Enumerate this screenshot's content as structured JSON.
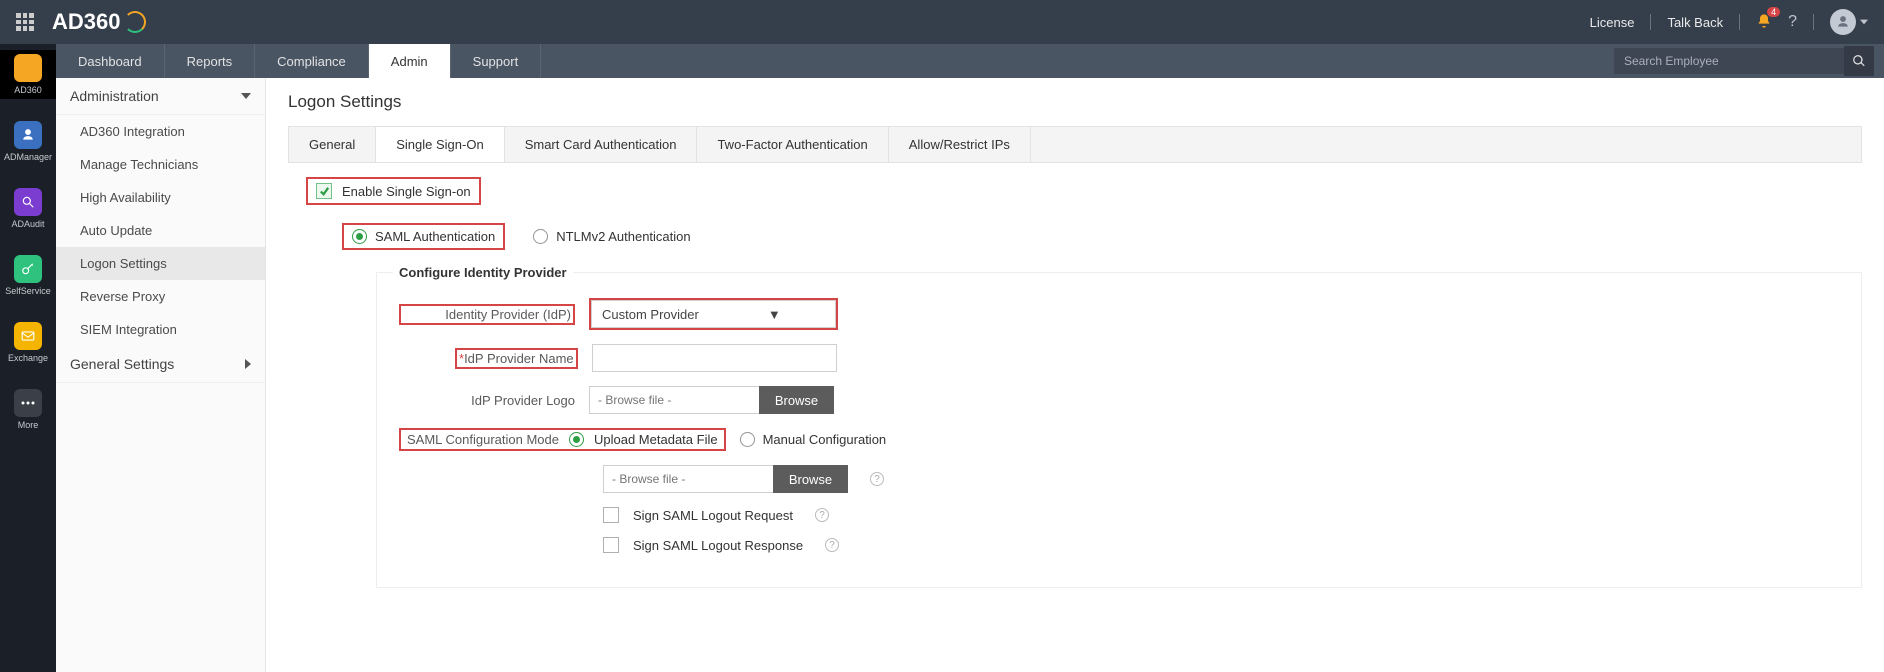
{
  "header": {
    "brand": "AD360",
    "license": "License",
    "talkback": "Talk Back",
    "notif_count": "4"
  },
  "main_tabs": [
    "Dashboard",
    "Reports",
    "Compliance",
    "Admin",
    "Support"
  ],
  "main_tabs_active": 3,
  "search_placeholder": "Search Employee",
  "leftrail": [
    "AD360",
    "ADManager",
    "ADAudit",
    "SelfService",
    "Exchange",
    "More"
  ],
  "sidebar": {
    "sections": [
      {
        "title": "Administration",
        "expanded": true,
        "items": [
          "AD360 Integration",
          "Manage Technicians",
          "High Availability",
          "Auto Update",
          "Logon Settings",
          "Reverse Proxy",
          "SIEM Integration"
        ],
        "active": 4
      },
      {
        "title": "General Settings",
        "expanded": false
      }
    ]
  },
  "page_title": "Logon Settings",
  "subtabs": [
    "General",
    "Single Sign-On",
    "Smart Card Authentication",
    "Two-Factor Authentication",
    "Allow/Restrict IPs"
  ],
  "subtabs_active": 1,
  "sso": {
    "enable_label": "Enable Single Sign-on",
    "enable_checked": true,
    "auth_radio": {
      "saml": "SAML Authentication",
      "ntlm": "NTLMv2 Authentication",
      "selected": "saml"
    },
    "panel_title": "Configure Identity Provider",
    "idp_label": "Identity Provider (IdP)",
    "idp_value": "Custom Provider",
    "idp_name_label": "IdP Provider Name",
    "idp_logo_label": "IdP Provider Logo",
    "browse_placeholder": "- Browse file -",
    "browse_btn": "Browse",
    "saml_mode_label": "SAML Configuration Mode",
    "mode_upload": "Upload Metadata File",
    "mode_manual": "Manual Configuration",
    "mode_selected": "upload",
    "sign_logout_req": "Sign SAML Logout Request",
    "sign_logout_resp": "Sign SAML Logout Response"
  }
}
